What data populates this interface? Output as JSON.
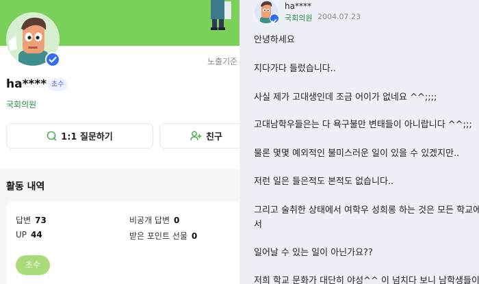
{
  "profile": {
    "name": "ha****",
    "grade_badge": "초수",
    "group": "국회의원",
    "expose_label": "노출기준",
    "question_button": "1:1 질문하기",
    "friend_button": "친구"
  },
  "activity": {
    "title": "활동 내역",
    "stats": [
      {
        "label": "답변",
        "value": "73"
      },
      {
        "label": "비공개 답변",
        "value": "0"
      },
      {
        "label": "UP",
        "value": "44"
      },
      {
        "label": "받은 포인트 선물",
        "value": "0"
      }
    ],
    "grade_pill": "초수"
  },
  "post": {
    "author": "ha****",
    "group": "국회의원",
    "date": "2004.07.23",
    "lines": [
      "안녕하세요",
      "지다가다 들렀습니다..",
      "사실 제가 고대생인데 조금 어이가 없네요 ^^;;;;",
      "고대남학우들은는 다 욕구불만 변태들이 아니랍니다 ^^;;;",
      "물론 몇몇 예외적인 불미스러운 일이 있을 수 있겠지만..",
      "저런 일은 들은적도 본적도 없습니다..",
      "그리고 술취한 상태에서 여학우 성희롱 하는 것은 모든 학교에",
      "서",
      "일어날 수 있는 일이 아닌가요??",
      "저희 학교 문화가 대단히 야성^^ 이 넘치다 보니 남학생들이"
    ]
  },
  "colors": {
    "banner": "#7bd05a",
    "verified": "#2f6df5",
    "group_text": "#2b8a3e",
    "grade_pill": "#a7dc78"
  },
  "icons": [
    "verified-check-icon",
    "question-circle-icon",
    "add-friend-icon"
  ]
}
